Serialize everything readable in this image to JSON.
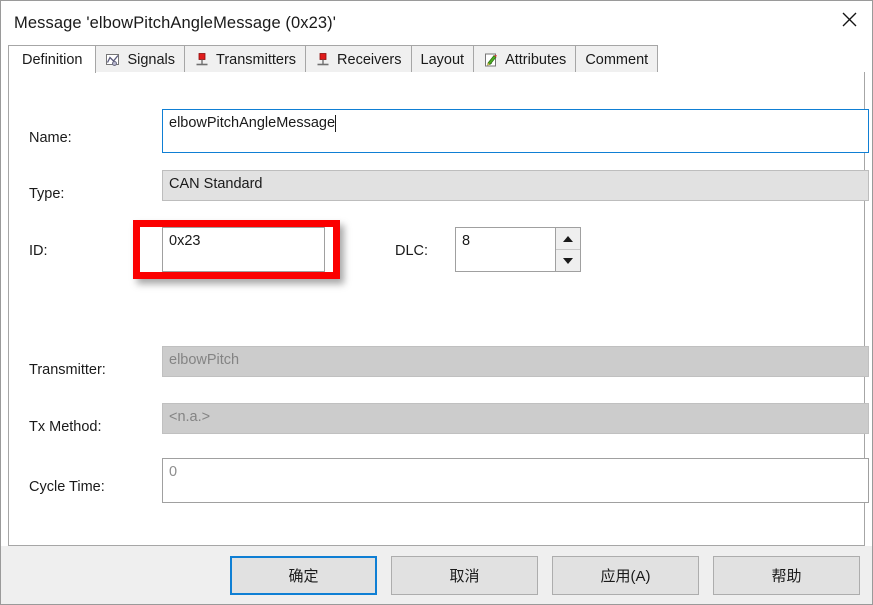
{
  "window": {
    "title": "Message 'elbowPitchAngleMessage (0x23)'",
    "close_icon": "close-icon"
  },
  "tabs": [
    {
      "label": "Definition",
      "icon": "",
      "selected": true
    },
    {
      "label": "Signals",
      "icon": "signals-icon",
      "selected": false
    },
    {
      "label": "Transmitters",
      "icon": "transmitter-pin-icon",
      "selected": false
    },
    {
      "label": "Receivers",
      "icon": "receiver-pin-icon",
      "selected": false
    },
    {
      "label": "Layout",
      "icon": "",
      "selected": false
    },
    {
      "label": "Attributes",
      "icon": "attributes-pencil-icon",
      "selected": false
    },
    {
      "label": "Comment",
      "icon": "",
      "selected": false
    }
  ],
  "form": {
    "name": {
      "label": "Name:",
      "value": "elbowPitchAngleMessage",
      "state": "focused"
    },
    "type": {
      "label": "Type:",
      "value": "CAN Standard",
      "state": "readonly"
    },
    "id": {
      "label": "ID:",
      "value": "0x23",
      "state": "editable"
    },
    "dlc": {
      "label": "DLC:",
      "value": "8",
      "state": "editable"
    },
    "transmitter": {
      "label": "Transmitter:",
      "value": "elbowPitch",
      "state": "disabled"
    },
    "tx_method": {
      "label": "Tx Method:",
      "value": "<n.a.>",
      "state": "disabled"
    },
    "cycle_time": {
      "label": "Cycle Time:",
      "value": "0",
      "state": "editable"
    }
  },
  "annotation": {
    "target": "id-field",
    "color": "#fb0000"
  },
  "footer": {
    "ok": "确定",
    "cancel": "取消",
    "apply": "应用(A)",
    "help": "帮助"
  },
  "colors": {
    "accent": "#0f7fd4",
    "annotation": "#fb0000",
    "disabled_bg": "#cccccc",
    "readonly_bg": "#e1e1e1",
    "footer_bg": "#efefef"
  }
}
